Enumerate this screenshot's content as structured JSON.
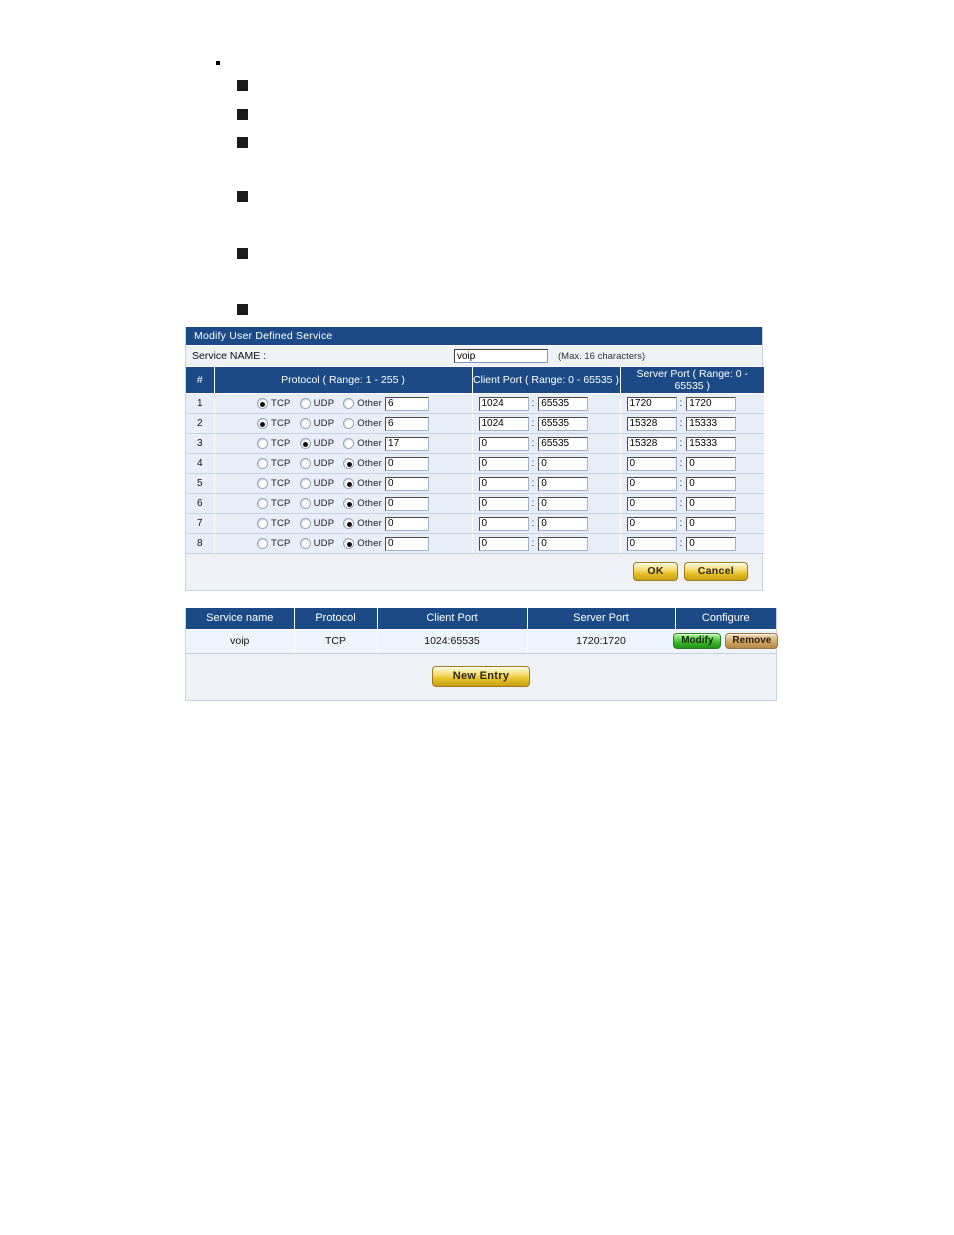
{
  "bullets": {
    "dot_marker": "·",
    "square_markers": [
      "■",
      "■",
      "■",
      "■",
      "■",
      "■"
    ],
    "square_tops": [
      80,
      109,
      137,
      191,
      248,
      304
    ]
  },
  "modify_panel": {
    "title": "Modify User Defined Service",
    "service_name_label": "Service NAME :",
    "service_name_value": "voip",
    "service_name_hint": "(Max. 16 characters)",
    "columns": {
      "index": "#",
      "protocol": "Protocol ( Range: 1 - 255 )",
      "client_port": "Client Port ( Range: 0 - 65535 )",
      "server_port": "Server Port ( Range: 0 - 65535 )"
    },
    "radio_labels": {
      "tcp": "TCP",
      "udp": "UDP",
      "other": "Other"
    },
    "port_separator": ":",
    "rows": [
      {
        "index": "1",
        "selected": "tcp",
        "other": "6",
        "client_from": "1024",
        "client_to": "65535",
        "server_from": "1720",
        "server_to": "1720"
      },
      {
        "index": "2",
        "selected": "tcp",
        "other": "6",
        "client_from": "1024",
        "client_to": "65535",
        "server_from": "15328",
        "server_to": "15333"
      },
      {
        "index": "3",
        "selected": "udp",
        "other": "17",
        "client_from": "0",
        "client_to": "65535",
        "server_from": "15328",
        "server_to": "15333"
      },
      {
        "index": "4",
        "selected": "other",
        "other": "0",
        "client_from": "0",
        "client_to": "0",
        "server_from": "0",
        "server_to": "0"
      },
      {
        "index": "5",
        "selected": "other",
        "other": "0",
        "client_from": "0",
        "client_to": "0",
        "server_from": "0",
        "server_to": "0"
      },
      {
        "index": "6",
        "selected": "other",
        "other": "0",
        "client_from": "0",
        "client_to": "0",
        "server_from": "0",
        "server_to": "0"
      },
      {
        "index": "7",
        "selected": "other",
        "other": "0",
        "client_from": "0",
        "client_to": "0",
        "server_from": "0",
        "server_to": "0"
      },
      {
        "index": "8",
        "selected": "other",
        "other": "0",
        "client_from": "0",
        "client_to": "0",
        "server_from": "0",
        "server_to": "0"
      }
    ],
    "ok_label": "OK",
    "cancel_label": "Cancel"
  },
  "list_panel": {
    "columns": {
      "service_name": "Service name",
      "protocol": "Protocol",
      "client_port": "Client Port",
      "server_port": "Server Port",
      "configure": "Configure"
    },
    "rows": [
      {
        "service_name": "voip",
        "protocol": "TCP",
        "client_port": "1024:65535",
        "server_port": "1720:1720",
        "modify_label": "Modify",
        "remove_label": "Remove"
      }
    ],
    "new_entry_label": "New  Entry"
  },
  "colors": {
    "header_blue": "#1b4a87",
    "panel_bg": "#eef1f6",
    "row_bg": "#e7eef8",
    "button_gold": "#e8c228",
    "modify_green": "#2fae22",
    "remove_tan": "#c99d5d"
  }
}
